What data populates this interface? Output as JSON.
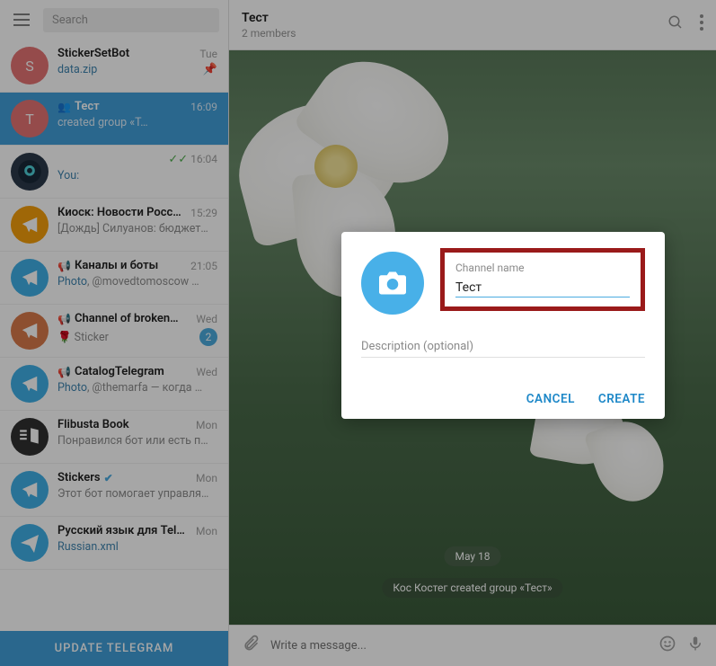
{
  "search_placeholder": "Search",
  "chats": [
    {
      "initial": "S",
      "avatarColor": "#e57373",
      "name": "StickerSetBot",
      "time": "Tue",
      "prev": "data.zip",
      "prevIsLink": true,
      "pinned": true
    },
    {
      "initial": "T",
      "avatarColor": "#e57373",
      "name": "Тест",
      "time": "16:09",
      "prev": "created group «Т…",
      "iconPrefix": "👥",
      "active": true
    },
    {
      "avatarImg": "robot",
      "avatarColor": "#2b3a4a",
      "name": "",
      "time": "16:04",
      "prev": "You:",
      "prevIsLink": true,
      "checks": true
    },
    {
      "avatarColor": "#f59e0b",
      "name": "Киоск: Новости Росс…",
      "time": "15:29",
      "prev": "[Дождь]  Силуанов: бюджет…"
    },
    {
      "avatarColor": "#3fb0e6",
      "name": "Каналы и боты",
      "time": "21:05",
      "prev": "Photo, @movedtomoscow …",
      "prevHasLink": "Photo",
      "channel": true
    },
    {
      "avatarColor": "#d97a4a",
      "name": "Channel of broken…",
      "time": "Wed",
      "prev": "🌹 Sticker",
      "badge": "2",
      "channel": true
    },
    {
      "avatarColor": "#3fb0e6",
      "name": "CatalogTelegram",
      "time": "Wed",
      "prev": "Photo, @themarfa — когда …",
      "prevHasLink": "Photo",
      "channel": true
    },
    {
      "avatarColor": "#303030",
      "name": "Flibusta Book",
      "time": "Mon",
      "prev": "Понравился бот или есть п…",
      "books": true
    },
    {
      "avatarColor": "#3fb0e6",
      "name": "Stickers",
      "time": "Mon",
      "prev": "Этот бот помогает управля…",
      "verified": true
    },
    {
      "avatarColor": "#3fb0e6",
      "name": "Русский язык для Tel…",
      "time": "Mon",
      "prev": "Russian.xml",
      "prevIsLink": true,
      "paperplane": true
    }
  ],
  "update_label": "UPDATE TELEGRAM",
  "header": {
    "title": "Тест",
    "subtitle": "2 members"
  },
  "date_pill": "May 18",
  "system_message": "Кос Костег created group «Тест»",
  "composer_placeholder": "Write a message...",
  "modal": {
    "name_label": "Channel name",
    "name_value": "Тест",
    "desc_placeholder": "Description (optional)",
    "cancel": "CANCEL",
    "create": "CREATE"
  }
}
